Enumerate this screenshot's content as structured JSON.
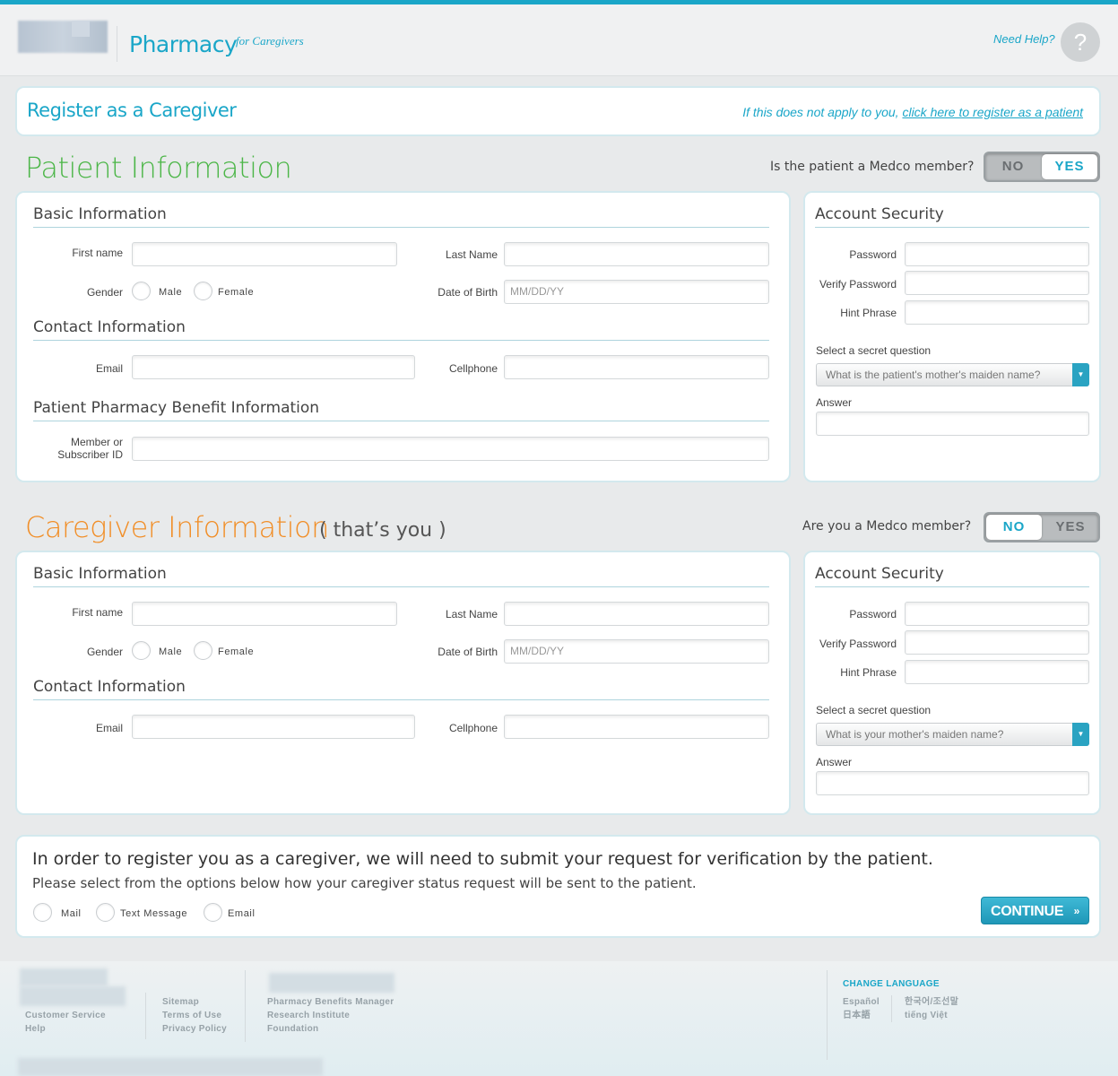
{
  "header": {
    "brand": "Pharmacy",
    "brand_sub": "for Caregivers",
    "help_link": "Need Help?",
    "help_icon": "?"
  },
  "register": {
    "title": "Register as a Caregiver",
    "note_prefix": "If this does not apply to you,",
    "note_link": "click here to register as a patient"
  },
  "patient": {
    "title": "Patient Information",
    "member_question": "Is the patient a Medco member?",
    "toggle_no": "NO",
    "toggle_yes": "YES",
    "toggle_selected": "YES",
    "basic_heading": "Basic Information",
    "first_name_label": "First name",
    "last_name_label": "Last Name",
    "gender_label": "Gender",
    "male_label": "Male",
    "female_label": "Female",
    "dob_label": "Date of Birth",
    "dob_placeholder": "MM/DD/YY",
    "contact_heading": "Contact Information",
    "email_label": "Email",
    "cellphone_label": "Cellphone",
    "benefit_heading": "Patient Pharmacy Benefit Information",
    "member_id_label_1": "Member or",
    "member_id_label_2": "Subscriber ID",
    "security_heading": "Account Security",
    "password_label": "Password",
    "verify_label": "Verify Password",
    "hint_label": "Hint Phrase",
    "secret_label": "Select a secret question",
    "secret_value": "What is the patient's mother's maiden name?",
    "answer_label": "Answer"
  },
  "caregiver": {
    "title": "Caregiver Information",
    "subtitle": "( that’s you )",
    "member_question": "Are you a Medco member?",
    "toggle_no": "NO",
    "toggle_yes": "YES",
    "toggle_selected": "NO",
    "basic_heading": "Basic Information",
    "first_name_label": "First name",
    "last_name_label": "Last Name",
    "gender_label": "Gender",
    "male_label": "Male",
    "female_label": "Female",
    "dob_label": "Date of Birth",
    "dob_placeholder": "MM/DD/YY",
    "contact_heading": "Contact Information",
    "email_label": "Email",
    "cellphone_label": "Cellphone",
    "security_heading": "Account Security",
    "password_label": "Password",
    "verify_label": "Verify Password",
    "hint_label": "Hint Phrase",
    "secret_label": "Select a secret question",
    "secret_value": "What is your mother's maiden name?",
    "answer_label": "Answer"
  },
  "verification": {
    "main_text": "In order to register you as a caregiver, we will need to submit your request for verification by the patient.",
    "sub_text": "Please select from the options below how your caregiver status request will be sent to the patient.",
    "options": [
      "Mail",
      "Text Message",
      "Email"
    ],
    "continue_label": "CONTINUE",
    "continue_chevron": "»"
  },
  "footer": {
    "col1": [
      "Customer Service",
      "Help"
    ],
    "col2": [
      "Sitemap",
      "Terms of Use",
      "Privacy Policy"
    ],
    "col3": [
      "Pharmacy Benefits Manager",
      "Research Institute",
      "Foundation"
    ],
    "language_heading": "CHANGE LANGUAGE",
    "languages": [
      "Español",
      "한국어/조선말",
      "日本語",
      "tiếng Việt"
    ]
  },
  "colors": {
    "accent": "#1aa6c8",
    "patient_title": "#4cb648",
    "caregiver_title": "#f18e27"
  }
}
